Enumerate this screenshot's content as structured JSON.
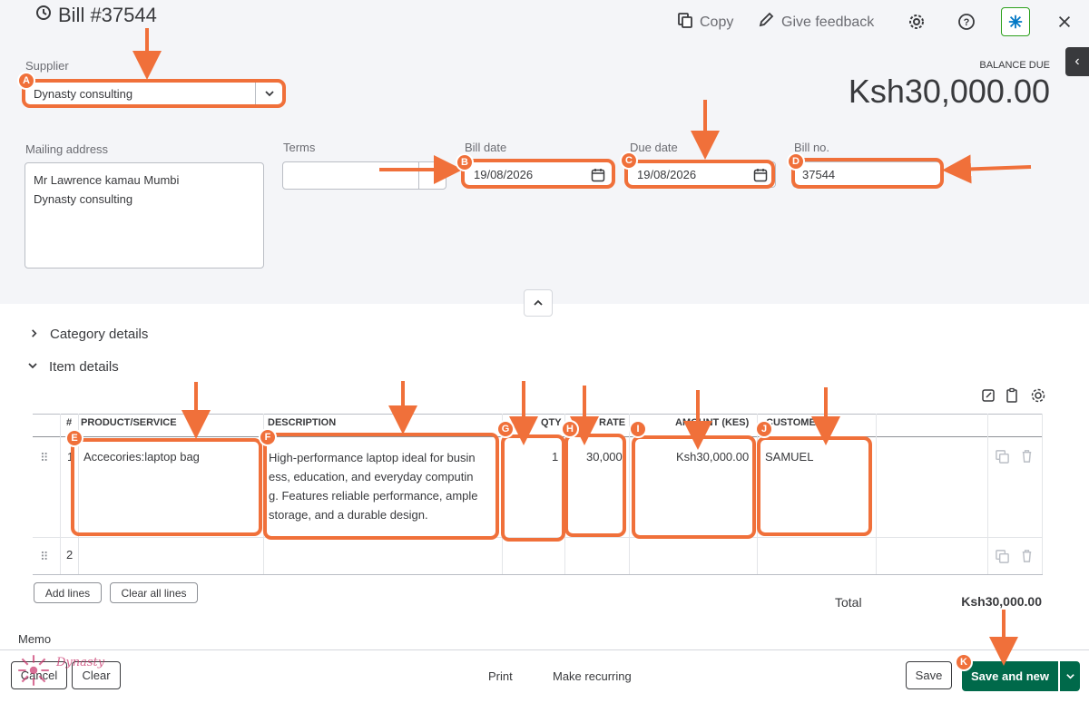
{
  "header": {
    "title": "Bill #37544",
    "copy_label": "Copy",
    "feedback_label": "Give feedback",
    "balance_due_label": "BALANCE DUE",
    "balance_due_value": "Ksh30,000.00"
  },
  "form": {
    "supplier_label": "Supplier",
    "supplier_value": "Dynasty consulting",
    "mailing_label": "Mailing address",
    "mailing_line1": "Mr Lawrence kamau Mumbi",
    "mailing_line2": "Dynasty consulting",
    "terms_label": "Terms",
    "terms_value": "",
    "bill_date_label": "Bill date",
    "bill_date_value": "19/08/2026",
    "due_date_label": "Due date",
    "due_date_value": "19/08/2026",
    "bill_no_label": "Bill no.",
    "bill_no_value": "37544"
  },
  "sections": {
    "category_details": "Category details",
    "item_details": "Item details"
  },
  "table": {
    "headers": [
      "#",
      "PRODUCT/SERVICE",
      "DESCRIPTION",
      "QTY",
      "RATE",
      "AMOUNT (KES)",
      "CUSTOMER"
    ],
    "rows": [
      {
        "num": "1",
        "product": "Accecories:laptop bag",
        "description": [
          "High-performance laptop ideal for busin",
          "ess, education, and everyday computin",
          "g. Features reliable performance, ample",
          "storage, and a durable design."
        ],
        "qty": "1",
        "rate": "30,000",
        "amount": "Ksh30,000.00",
        "customer": "SAMUEL"
      },
      {
        "num": "2",
        "product": "",
        "description": [],
        "qty": "",
        "rate": "",
        "amount": "",
        "customer": ""
      }
    ],
    "add_lines": "Add lines",
    "clear_all_lines": "Clear all lines",
    "total_label": "Total",
    "total_value": "Ksh30,000.00"
  },
  "memo_label": "Memo",
  "footer": {
    "cancel": "Cancel",
    "clear": "Clear",
    "print": "Print",
    "make_recurring": "Make recurring",
    "save": "Save",
    "save_and_new": "Save and new",
    "logo_text": "Dynasty"
  },
  "annotations": [
    "A",
    "B",
    "C",
    "D",
    "E",
    "F",
    "G",
    "H",
    "I",
    "J",
    "K"
  ],
  "colors": {
    "accent": "#f0703a",
    "primary_dark": "#00694a",
    "panel": "#f4f5f8"
  }
}
